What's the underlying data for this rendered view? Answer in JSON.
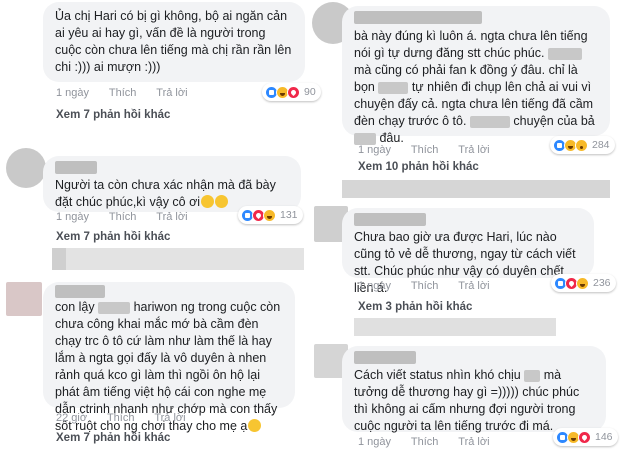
{
  "actions": {
    "like": "Thích",
    "reply": "Trả lời"
  },
  "left": {
    "comments": [
      {
        "text": "Ủa chị Hari có bị gì không, bộ ai ngăn cản ai yêu ai hay gì, vấn đề là người trong cuộc còn chưa lên tiếng mà chị rần rần lên chi :))) ai mượn :)))",
        "time": "1 ngày",
        "reaction_count": "90",
        "more_replies": "Xem 7 phản hồi khác"
      },
      {
        "text": "Người ta còn chưa xác nhận mà đã bày đặt chúc phúc,kì vậy cô ơi",
        "time": "1 ngày",
        "reaction_count": "131",
        "more_replies": "Xem 7 phản hồi khác"
      },
      {
        "text_part1": "con lậy",
        "text_part2": "hariwon ng trong cuộc còn chưa công khai mắc mớ bà cầm đèn chạy trc ô tô cứ làm như làm thế là hay lắm à ngta gọi đấy là vô duyên à nhen rảnh quá kco gì làm thì ngồi ôn hộ lại phát âm tiếng việt hộ cái con nghe mẹ dẫn ctrinh nhanh như chớp mà con thấy sốt ruột cho ng chơi thay cho mẹ ạ",
        "time": "22 giờ",
        "reaction_count": "",
        "more_replies": "Xem 7 phản hồi khác"
      }
    ]
  },
  "right": {
    "comments": [
      {
        "text_part1": "bà này đúng kì luôn á. ngta chưa lên tiếng nói gì tự dưng đăng stt chúc phúc.",
        "text_part2": "mà cũng có phải fan k đồng ý đâu. chỉ là bọn",
        "text_part3": "tự nhiên đi chụp lên chả ai vui vì chuyện đấy cả. ngta chưa lên tiếng đã cầm đèn chạy trước ô tô.",
        "text_part4": "chuyện của bả",
        "text_part5": "đâu.",
        "time": "1 ngày",
        "reaction_count": "284",
        "more_replies": "Xem 10 phản hồi khác"
      },
      {
        "text": "Chưa bao giờ ưa được Hari, lúc nào cũng tỏ vẻ dễ thương, ngay từ cách viết stt. Chúc phúc như vậy có duyên chết liền á.",
        "time": "1 ngày",
        "reaction_count": "236",
        "more_replies": "Xem 3 phản hồi khác"
      },
      {
        "text_part1": "Cách viết status nhìn khó chịu",
        "text_part2": "mà tưởng dễ thương hay gì =))))) chúc phúc thì không ai cấm nhưng đợi người trong cuộc người ta lên tiếng trước đi má.",
        "time": "1 ngày",
        "reaction_count": "146",
        "more_replies": ""
      }
    ]
  }
}
